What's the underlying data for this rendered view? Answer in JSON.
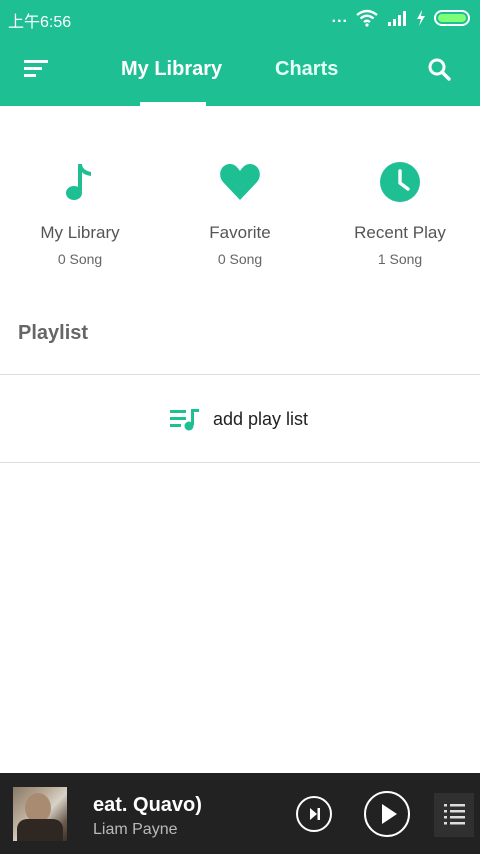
{
  "status_bar": {
    "time": "上午6:56",
    "dots": "...",
    "battery_color": "#7dff7a"
  },
  "header": {
    "background_color": "#1fbf94",
    "menu_icon": "menu-icon",
    "tabs": [
      {
        "label": "My Library",
        "active": true
      },
      {
        "label": "Charts",
        "active": false
      }
    ],
    "search_icon": "search-icon"
  },
  "quick_access": [
    {
      "icon": "music-note-icon",
      "title": "My Library",
      "count": "0 Song"
    },
    {
      "icon": "heart-icon",
      "title": "Favorite",
      "count": "0 Song"
    },
    {
      "icon": "clock-icon",
      "title": "Recent Play",
      "count": "1 Song"
    }
  ],
  "playlist": {
    "section_title": "Playlist",
    "add_icon": "playlist-add-icon",
    "add_label": "add play list"
  },
  "player": {
    "track_title": "eat. Quavo)",
    "artist": "Liam Payne",
    "next_icon": "skip-next-icon",
    "play_icon": "play-icon",
    "queue_icon": "queue-list-icon"
  },
  "accent_color": "#1fbf94"
}
